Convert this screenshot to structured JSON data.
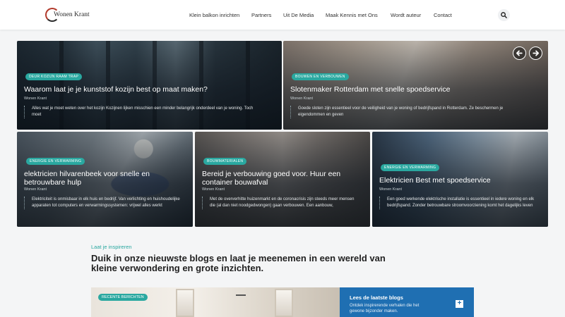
{
  "logo": {
    "text": "Wonen Krant"
  },
  "nav": {
    "items": [
      "Klein balkon inrichten",
      "Partners",
      "Uit De Media",
      "Maak Kennis met Ons",
      "Wordt auteur",
      "Contact"
    ]
  },
  "cards": [
    {
      "badge": "Deur Kozijn Raam Trap",
      "title": "Waarom laat je je kunststof kozijn best op maat maken?",
      "author": "Wonen Krant",
      "excerpt": "Alles wat je moet weten over het kozijn Kozijnen lijken misschien een minder belangrijk onderdeel van je woning. Toch moet"
    },
    {
      "badge": "Bouwen en Verbouwen",
      "title": "Slotenmaker Rotterdam met snelle spoedservice",
      "author": "Wonen Krant",
      "excerpt": "Goede sloten zijn essentieel voor de veiligheid van je woning of bedrijfspand in Rotterdam. Ze beschermen je eigendommen en geven"
    },
    {
      "badge": "Energie en Verwarming",
      "title": "elektricien hilvarenbeek voor snelle en betrouwbare hulp",
      "author": "Wonen Krant",
      "excerpt": "Elektriciteit is onmisbaar in elk huis en bedrijf. Van verlichting en huishoudelijke apparaten tot computers en verwarmingssystemen: vrijwel alles werkt"
    },
    {
      "badge": "Bouwmaterialen",
      "title": "Bereid je verbouwing goed voor. Huur een container bouwafval",
      "author": "Wonen Krant",
      "excerpt": "Met de oververhitte huizenmarkt en de coronacrisis zijn steeds meer mensen die (al dan niet noodgedwongen) gaan verbouwen. Een aanbouw,"
    },
    {
      "badge": "Energie en Verwarming",
      "title": "Elektricien Best met spoedservice",
      "author": "Wonen Krant",
      "excerpt": "Een goed werkende elektrische installatie is essentieel in iedere woning en elk bedrijfspand. Zonder betrouwbare stroomvoorziening komt het dagelijks leven"
    }
  ],
  "inspire": {
    "eyebrow": "Laat je inspireren",
    "headline": "Duik in onze nieuwste blogs en laat je meenemen in een wereld van kleine verwondering en grote inzichten."
  },
  "recent": {
    "badge": "Recente berichten",
    "panel_title": "Lees de laatste blogs",
    "panel_text": "Ontdek inspirerende verhalen die het gewone bijzonder maken.",
    "panel_icon": "plus-icon"
  },
  "icons": {
    "search": "search-icon",
    "prev": "arrow-left-icon",
    "next": "arrow-right-icon"
  },
  "colors": {
    "accent": "#2aa8a0",
    "panel": "#1f6fb2"
  }
}
